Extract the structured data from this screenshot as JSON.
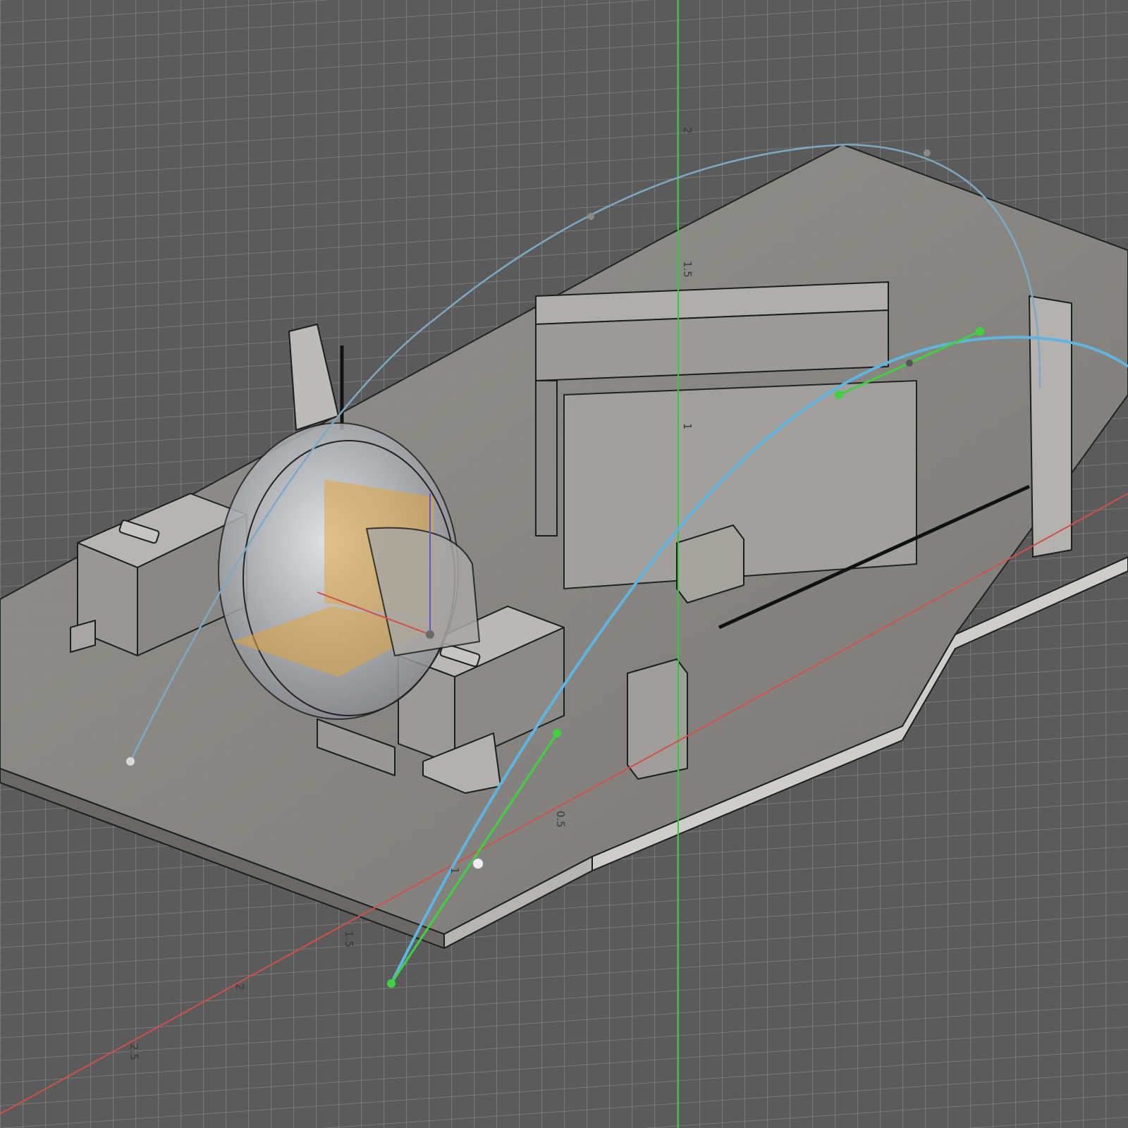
{
  "viewport": {
    "background": "#5b5b5b",
    "grid_color": "#8a8a8a",
    "axes": {
      "vertical_axis_color": "#33cc33",
      "horizontal_axis_color": "#d0504a"
    },
    "dimension_labels": {
      "vertical_2": "2",
      "vertical_1_5": "1.5",
      "vertical_1": "1",
      "vertical_0_5": "0.5",
      "diagonal_1": "1",
      "diagonal_1_5": "1.5",
      "diagonal_2": "2",
      "diagonal_2_5": "2.5"
    }
  },
  "model": {
    "base_plate_color": "#8c8a86",
    "component_color": "#a8a6a2",
    "lens_color": "#c9ccd2",
    "section_plane_color": "#e0a640"
  },
  "sketch_curves": {
    "outer_arc_color": "#7ea9c4",
    "inner_arc_color": "#5fb4e0",
    "handle_color": "#3fd13f"
  }
}
